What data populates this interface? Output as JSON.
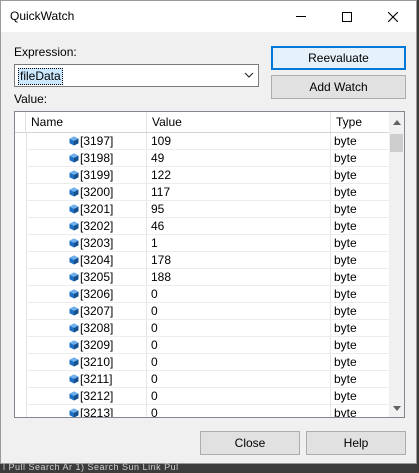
{
  "window": {
    "title": "QuickWatch"
  },
  "expression": {
    "label": "Expression:",
    "value": "fileData"
  },
  "value_label": "Value:",
  "buttons": {
    "reevaluate": "Reevaluate",
    "add_watch": "Add Watch",
    "close": "Close",
    "help": "Help"
  },
  "grid": {
    "columns": [
      "Name",
      "Value",
      "Type"
    ],
    "rows": [
      {
        "name": "[3197]",
        "value": "109",
        "type": "byte"
      },
      {
        "name": "[3198]",
        "value": "49",
        "type": "byte"
      },
      {
        "name": "[3199]",
        "value": "122",
        "type": "byte"
      },
      {
        "name": "[3200]",
        "value": "117",
        "type": "byte"
      },
      {
        "name": "[3201]",
        "value": "95",
        "type": "byte"
      },
      {
        "name": "[3202]",
        "value": "46",
        "type": "byte"
      },
      {
        "name": "[3203]",
        "value": "1",
        "type": "byte"
      },
      {
        "name": "[3204]",
        "value": "178",
        "type": "byte"
      },
      {
        "name": "[3205]",
        "value": "188",
        "type": "byte"
      },
      {
        "name": "[3206]",
        "value": "0",
        "type": "byte"
      },
      {
        "name": "[3207]",
        "value": "0",
        "type": "byte"
      },
      {
        "name": "[3208]",
        "value": "0",
        "type": "byte"
      },
      {
        "name": "[3209]",
        "value": "0",
        "type": "byte"
      },
      {
        "name": "[3210]",
        "value": "0",
        "type": "byte"
      },
      {
        "name": "[3211]",
        "value": "0",
        "type": "byte"
      },
      {
        "name": "[3212]",
        "value": "0",
        "type": "byte"
      },
      {
        "name": "[3213]",
        "value": "0",
        "type": "byte"
      }
    ]
  },
  "background_text": "l Pull Search Ar 1) Search Sun Link Pul"
}
